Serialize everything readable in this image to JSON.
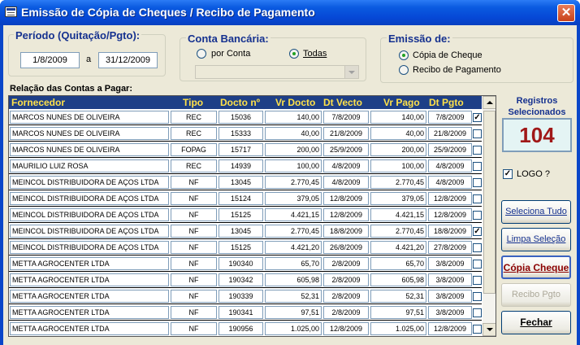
{
  "window": {
    "title": "Emissão de Cópia de Cheques / Recibo de Pagamento",
    "close": "✕"
  },
  "periodo": {
    "title": "Período (Quitação/Pgto):",
    "from": "1/8/2009",
    "sep": "a",
    "to": "31/12/2009"
  },
  "conta": {
    "title": "Conta Bancária:",
    "opt_por_conta": "por Conta",
    "opt_todas": "Todas",
    "selected": "Todas",
    "combo_value": ""
  },
  "emissao": {
    "title": "Emissão de:",
    "opt_cheque": "Cópia de Cheque",
    "opt_recibo": "Recibo de Pagamento",
    "selected": "Cópia de Cheque"
  },
  "list_title": "Relação das Contas a Pagar:",
  "columns": [
    "Fornecedor",
    "Tipo",
    "Docto nº",
    "Vr Docto",
    "Dt Vecto",
    "Vr Pago",
    "Dt Pgto"
  ],
  "rows": [
    [
      "MARCOS NUNES DE OLIVEIRA",
      "REC",
      "15036",
      "140,00",
      "7/8/2009",
      "140,00",
      "7/8/2009",
      true
    ],
    [
      "MARCOS NUNES DE OLIVEIRA",
      "REC",
      "15333",
      "40,00",
      "21/8/2009",
      "40,00",
      "21/8/2009",
      false
    ],
    [
      "MARCOS NUNES DE OLIVEIRA",
      "FOPAG",
      "15717",
      "200,00",
      "25/9/2009",
      "200,00",
      "25/9/2009",
      false
    ],
    [
      "MAURILIO LUIZ ROSA",
      "REC",
      "14939",
      "100,00",
      "4/8/2009",
      "100,00",
      "4/8/2009",
      false
    ],
    [
      "MEINCOL DISTRIBUIDORA DE AÇOS LTDA",
      "NF",
      "13045",
      "2.770,45",
      "4/8/2009",
      "2.770,45",
      "4/8/2009",
      false
    ],
    [
      "MEINCOL DISTRIBUIDORA DE AÇOS LTDA",
      "NF",
      "15124",
      "379,05",
      "12/8/2009",
      "379,05",
      "12/8/2009",
      false
    ],
    [
      "MEINCOL DISTRIBUIDORA DE AÇOS LTDA",
      "NF",
      "15125",
      "4.421,15",
      "12/8/2009",
      "4.421,15",
      "12/8/2009",
      false
    ],
    [
      "MEINCOL DISTRIBUIDORA DE AÇOS LTDA",
      "NF",
      "13045",
      "2.770,45",
      "18/8/2009",
      "2.770,45",
      "18/8/2009",
      true
    ],
    [
      "MEINCOL DISTRIBUIDORA DE AÇOS LTDA",
      "NF",
      "15125",
      "4.421,20",
      "26/8/2009",
      "4.421,20",
      "27/8/2009",
      false
    ],
    [
      "METTA AGROCENTER LTDA",
      "NF",
      "190340",
      "65,70",
      "2/8/2009",
      "65,70",
      "3/8/2009",
      false
    ],
    [
      "METTA AGROCENTER LTDA",
      "NF",
      "190342",
      "605,98",
      "2/8/2009",
      "605,98",
      "3/8/2009",
      false
    ],
    [
      "METTA AGROCENTER LTDA",
      "NF",
      "190339",
      "52,31",
      "2/8/2009",
      "52,31",
      "3/8/2009",
      false
    ],
    [
      "METTA AGROCENTER LTDA",
      "NF",
      "190341",
      "97,51",
      "2/8/2009",
      "97,51",
      "3/8/2009",
      false
    ],
    [
      "METTA AGROCENTER LTDA",
      "NF",
      "190956",
      "1.025,00",
      "12/8/2009",
      "1.025,00",
      "12/8/2009",
      false
    ]
  ],
  "registros": {
    "title": "Registros Selecionados",
    "count": "104"
  },
  "logo": {
    "label": "LOGO ?",
    "checked": true
  },
  "buttons": {
    "seleciona_tudo": "Seleciona Tudo",
    "limpa_selecao": "Limpa Seleção",
    "copia_cheque": "Cópia Cheque",
    "recibo_pgto": "Recibo Pgto",
    "fechar": "Fechar"
  },
  "colors": {
    "title_bar": "#0a5ae0",
    "grid_header_bg": "#1e3f87",
    "grid_header_text": "#ffe14a",
    "count_text": "#a01818"
  }
}
